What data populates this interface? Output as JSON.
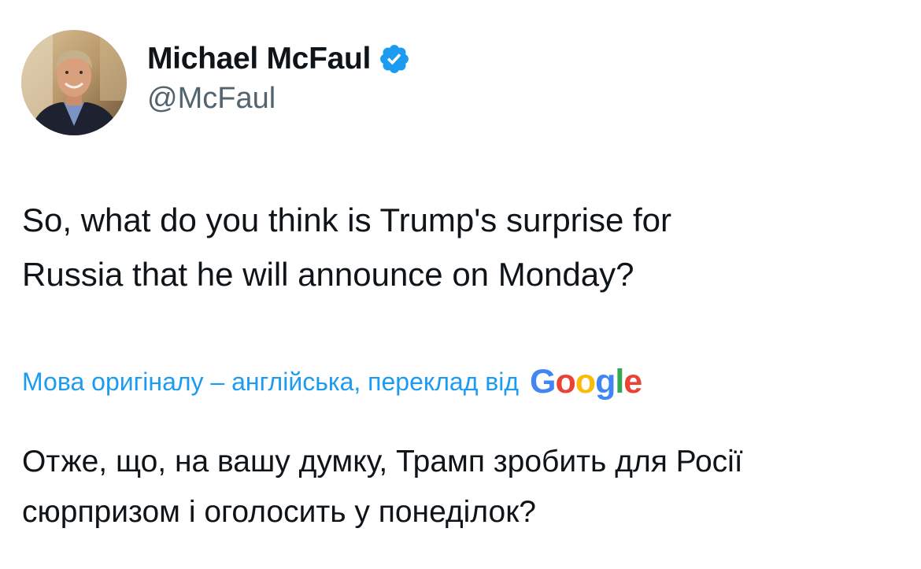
{
  "author": {
    "display_name": "Michael McFaul",
    "handle": "@McFaul",
    "verified": true
  },
  "tweet": {
    "text_line1": "So, what do you think is Trump's surprise for",
    "text_line2": "Russia that he will announce on Monday?"
  },
  "translation": {
    "label": "Мова оригіналу – англійська, переклад від",
    "provider": [
      "G",
      "o",
      "o",
      "g",
      "l",
      "e"
    ],
    "provider_colors": [
      "#4285F4",
      "#EA4335",
      "#FBBC05",
      "#4285F4",
      "#34A853",
      "#EA4335"
    ],
    "text_line1": "Отже, що, на вашу думку, Трамп зробить для Росії",
    "text_line2": "сюрпризом і оголосить у понеділок?"
  },
  "colors": {
    "accent": "#1d9bf0",
    "text_primary": "#0f1419",
    "text_secondary": "#536471"
  },
  "icons": {
    "verified": "verified-badge-icon",
    "avatar": "profile-photo"
  }
}
